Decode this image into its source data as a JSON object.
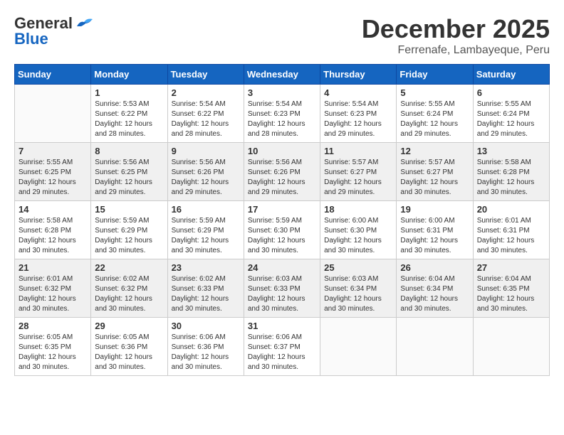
{
  "logo": {
    "general": "General",
    "blue": "Blue"
  },
  "title": "December 2025",
  "subtitle": "Ferrenafe, Lambayeque, Peru",
  "days_header": [
    "Sunday",
    "Monday",
    "Tuesday",
    "Wednesday",
    "Thursday",
    "Friday",
    "Saturday"
  ],
  "weeks": [
    [
      {
        "day": "",
        "info": ""
      },
      {
        "day": "1",
        "info": "Sunrise: 5:53 AM\nSunset: 6:22 PM\nDaylight: 12 hours\nand 28 minutes."
      },
      {
        "day": "2",
        "info": "Sunrise: 5:54 AM\nSunset: 6:22 PM\nDaylight: 12 hours\nand 28 minutes."
      },
      {
        "day": "3",
        "info": "Sunrise: 5:54 AM\nSunset: 6:23 PM\nDaylight: 12 hours\nand 28 minutes."
      },
      {
        "day": "4",
        "info": "Sunrise: 5:54 AM\nSunset: 6:23 PM\nDaylight: 12 hours\nand 29 minutes."
      },
      {
        "day": "5",
        "info": "Sunrise: 5:55 AM\nSunset: 6:24 PM\nDaylight: 12 hours\nand 29 minutes."
      },
      {
        "day": "6",
        "info": "Sunrise: 5:55 AM\nSunset: 6:24 PM\nDaylight: 12 hours\nand 29 minutes."
      }
    ],
    [
      {
        "day": "7",
        "info": "Sunrise: 5:55 AM\nSunset: 6:25 PM\nDaylight: 12 hours\nand 29 minutes."
      },
      {
        "day": "8",
        "info": "Sunrise: 5:56 AM\nSunset: 6:25 PM\nDaylight: 12 hours\nand 29 minutes."
      },
      {
        "day": "9",
        "info": "Sunrise: 5:56 AM\nSunset: 6:26 PM\nDaylight: 12 hours\nand 29 minutes."
      },
      {
        "day": "10",
        "info": "Sunrise: 5:56 AM\nSunset: 6:26 PM\nDaylight: 12 hours\nand 29 minutes."
      },
      {
        "day": "11",
        "info": "Sunrise: 5:57 AM\nSunset: 6:27 PM\nDaylight: 12 hours\nand 29 minutes."
      },
      {
        "day": "12",
        "info": "Sunrise: 5:57 AM\nSunset: 6:27 PM\nDaylight: 12 hours\nand 30 minutes."
      },
      {
        "day": "13",
        "info": "Sunrise: 5:58 AM\nSunset: 6:28 PM\nDaylight: 12 hours\nand 30 minutes."
      }
    ],
    [
      {
        "day": "14",
        "info": "Sunrise: 5:58 AM\nSunset: 6:28 PM\nDaylight: 12 hours\nand 30 minutes."
      },
      {
        "day": "15",
        "info": "Sunrise: 5:59 AM\nSunset: 6:29 PM\nDaylight: 12 hours\nand 30 minutes."
      },
      {
        "day": "16",
        "info": "Sunrise: 5:59 AM\nSunset: 6:29 PM\nDaylight: 12 hours\nand 30 minutes."
      },
      {
        "day": "17",
        "info": "Sunrise: 5:59 AM\nSunset: 6:30 PM\nDaylight: 12 hours\nand 30 minutes."
      },
      {
        "day": "18",
        "info": "Sunrise: 6:00 AM\nSunset: 6:30 PM\nDaylight: 12 hours\nand 30 minutes."
      },
      {
        "day": "19",
        "info": "Sunrise: 6:00 AM\nSunset: 6:31 PM\nDaylight: 12 hours\nand 30 minutes."
      },
      {
        "day": "20",
        "info": "Sunrise: 6:01 AM\nSunset: 6:31 PM\nDaylight: 12 hours\nand 30 minutes."
      }
    ],
    [
      {
        "day": "21",
        "info": "Sunrise: 6:01 AM\nSunset: 6:32 PM\nDaylight: 12 hours\nand 30 minutes."
      },
      {
        "day": "22",
        "info": "Sunrise: 6:02 AM\nSunset: 6:32 PM\nDaylight: 12 hours\nand 30 minutes."
      },
      {
        "day": "23",
        "info": "Sunrise: 6:02 AM\nSunset: 6:33 PM\nDaylight: 12 hours\nand 30 minutes."
      },
      {
        "day": "24",
        "info": "Sunrise: 6:03 AM\nSunset: 6:33 PM\nDaylight: 12 hours\nand 30 minutes."
      },
      {
        "day": "25",
        "info": "Sunrise: 6:03 AM\nSunset: 6:34 PM\nDaylight: 12 hours\nand 30 minutes."
      },
      {
        "day": "26",
        "info": "Sunrise: 6:04 AM\nSunset: 6:34 PM\nDaylight: 12 hours\nand 30 minutes."
      },
      {
        "day": "27",
        "info": "Sunrise: 6:04 AM\nSunset: 6:35 PM\nDaylight: 12 hours\nand 30 minutes."
      }
    ],
    [
      {
        "day": "28",
        "info": "Sunrise: 6:05 AM\nSunset: 6:35 PM\nDaylight: 12 hours\nand 30 minutes."
      },
      {
        "day": "29",
        "info": "Sunrise: 6:05 AM\nSunset: 6:36 PM\nDaylight: 12 hours\nand 30 minutes."
      },
      {
        "day": "30",
        "info": "Sunrise: 6:06 AM\nSunset: 6:36 PM\nDaylight: 12 hours\nand 30 minutes."
      },
      {
        "day": "31",
        "info": "Sunrise: 6:06 AM\nSunset: 6:37 PM\nDaylight: 12 hours\nand 30 minutes."
      },
      {
        "day": "",
        "info": ""
      },
      {
        "day": "",
        "info": ""
      },
      {
        "day": "",
        "info": ""
      }
    ]
  ]
}
